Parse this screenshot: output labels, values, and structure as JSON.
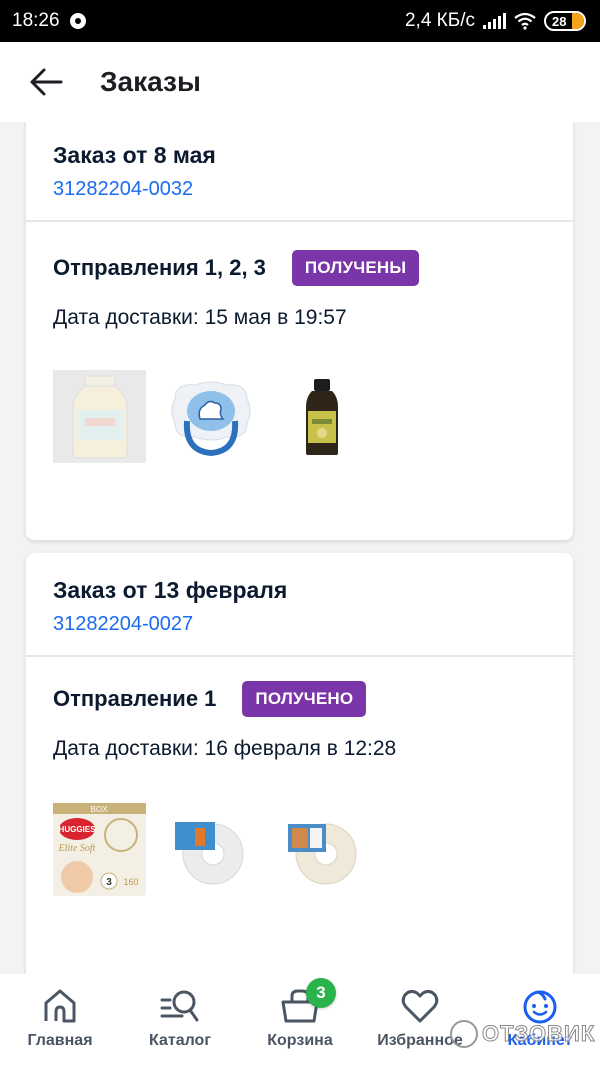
{
  "statusbar": {
    "time": "18:26",
    "network_speed": "2,4 КБ/с",
    "battery": "28"
  },
  "appbar": {
    "title": "Заказы",
    "back_icon": "arrow-left-icon"
  },
  "orders": [
    {
      "title": "Заказ от 8 мая",
      "number": "31282204-0032",
      "shipment_title": "Отправления 1, 2, 3",
      "status": "ПОЛУЧЕНЫ",
      "delivery": "Дата доставки: 15 мая в 19:57",
      "items": [
        "cream-jar",
        "baby-pacifier",
        "medicine-bottle"
      ]
    },
    {
      "title": "Заказ от 13 февраля",
      "number": "31282204-0027",
      "shipment_title": "Отправление 1",
      "status": "ПОЛУЧЕНО",
      "delivery": "Дата доставки: 16 февраля в 12:28",
      "items": [
        "huggies-elite-soft-diapers",
        "tape-roll",
        "tape-roll"
      ]
    }
  ],
  "diapers_pack": {
    "box": "BOX",
    "brand": "HUGGIES",
    "line": "Elite Soft",
    "size": "3",
    "count": "160"
  },
  "tabbar": {
    "items": [
      {
        "label": "Главная",
        "icon": "home-icon"
      },
      {
        "label": "Каталог",
        "icon": "catalog-search-icon"
      },
      {
        "label": "Корзина",
        "icon": "basket-icon",
        "badge": "3"
      },
      {
        "label": "Избранное",
        "icon": "heart-icon"
      },
      {
        "label": "Кабинет",
        "icon": "baby-face-icon",
        "active": true
      }
    ]
  },
  "colors": {
    "accent_blue": "#1a5ff0",
    "link_blue": "#1a6bf0",
    "status_purple": "#7a35a8",
    "cart_badge_green": "#2bb34b"
  },
  "watermark": "ОТЗОВИК"
}
